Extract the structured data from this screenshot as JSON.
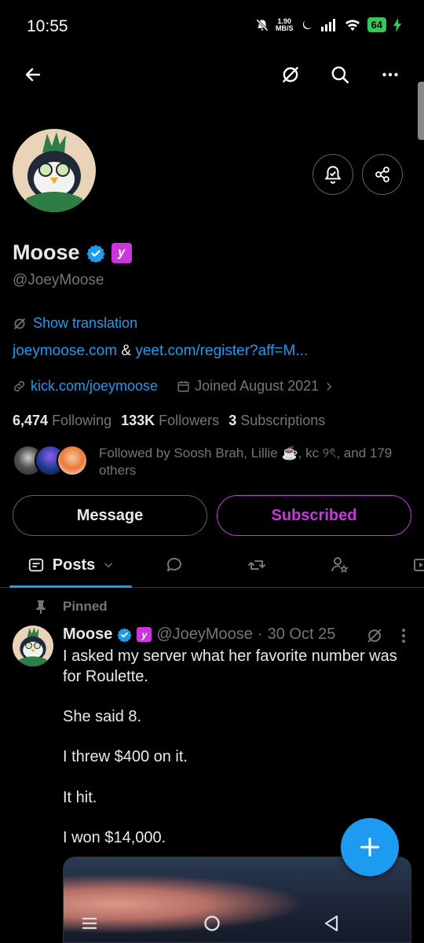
{
  "status_bar": {
    "time": "10:55",
    "net_speed_value": "1.90",
    "net_speed_unit": "MB/S",
    "battery": "64"
  },
  "profile": {
    "name": "Moose",
    "handle": "@JoeyMoose",
    "show_translation": "Show translation",
    "website_link": "joeymoose.com",
    "link_separator": "&",
    "referral_link": "yeet.com/register?aff=M...",
    "kick_link": "kick.com/joeymoose",
    "joined": "Joined August 2021",
    "following_count": "6,474",
    "following_label": "Following",
    "followers_count": "133K",
    "followers_label": "Followers",
    "subscriptions_count": "3",
    "subscriptions_label": "Subscriptions",
    "followed_by": "Followed by Soosh Brah, Lillie ☕️, kc ୨ৎ, and 179 others"
  },
  "buttons": {
    "message": "Message",
    "subscribed": "Subscribed"
  },
  "tabs": {
    "posts": "Posts"
  },
  "pinned_post": {
    "pinned_label": "Pinned",
    "author_name": "Moose",
    "author_handle": "@JoeyMoose",
    "separator": "·",
    "date": "30 Oct 25",
    "paragraphs": [
      "I asked my server what her favorite number was for Roulette.",
      "She said 8.",
      "I threw $400 on it.",
      "It hit.",
      "I won $14,000."
    ]
  },
  "colors": {
    "accent_blue": "#1d9bf0",
    "subscription_purple": "#c936de",
    "battery_green": "#34c759",
    "muted_text": "#71767b"
  },
  "icons": [
    "back-arrow-icon",
    "translate-icon",
    "search-icon",
    "more-icon",
    "notification-bell-icon",
    "share-icon",
    "verified-badge-icon",
    "subscription-badge-icon",
    "link-icon",
    "calendar-icon",
    "chevron-right-icon",
    "posts-icon",
    "replies-icon",
    "reposts-icon",
    "affiliates-icon",
    "media-icon",
    "pin-icon",
    "compose-plus-icon"
  ]
}
